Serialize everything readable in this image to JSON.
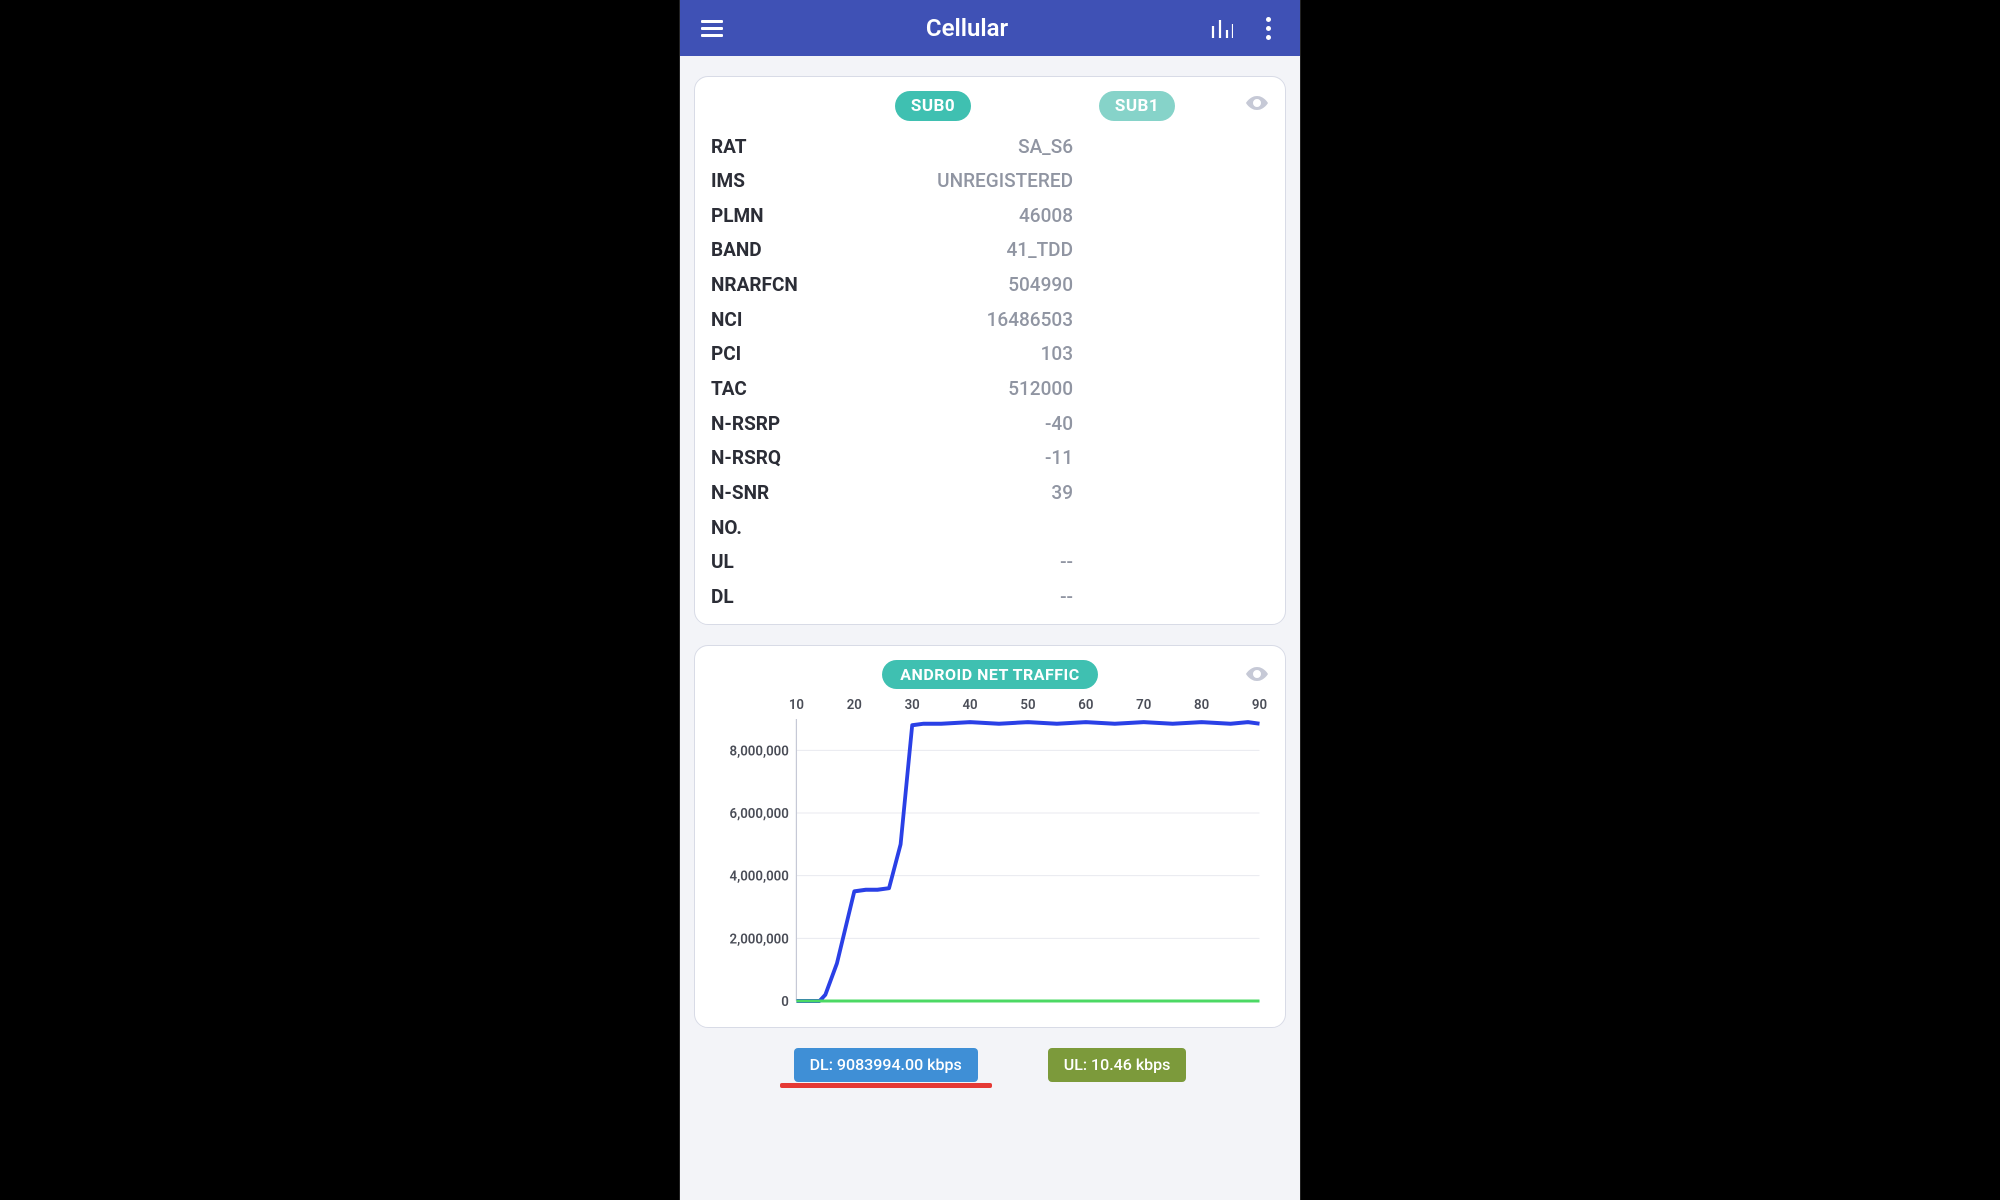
{
  "header": {
    "title": "Cellular"
  },
  "sim_card": {
    "sub0_label": "SUB0",
    "sub1_label": "SUB1",
    "rows": [
      {
        "key": "RAT",
        "val": "SA_S6"
      },
      {
        "key": "IMS",
        "val": "UNREGISTERED"
      },
      {
        "key": "PLMN",
        "val": "46008"
      },
      {
        "key": "BAND",
        "val": "41_TDD"
      },
      {
        "key": "NRARFCN",
        "val": "504990"
      },
      {
        "key": "NCI",
        "val": "16486503"
      },
      {
        "key": "PCI",
        "val": "103"
      },
      {
        "key": "TAC",
        "val": "512000"
      },
      {
        "key": "N-RSRP",
        "val": "-40"
      },
      {
        "key": "N-RSRQ",
        "val": "-11"
      },
      {
        "key": "N-SNR",
        "val": "39"
      },
      {
        "key": "NO.",
        "val": ""
      },
      {
        "key": "UL",
        "val": "--"
      },
      {
        "key": "DL",
        "val": "--"
      }
    ]
  },
  "traffic": {
    "title": "ANDROID NET TRAFFIC",
    "dl_label": "DL: 9083994.00 kbps",
    "ul_label": "UL: 10.46 kbps"
  },
  "chart_data": {
    "type": "line",
    "title": "ANDROID NET TRAFFIC",
    "xlabel": "",
    "ylabel": "",
    "xlim": [
      10,
      90
    ],
    "ylim": [
      0,
      9000000
    ],
    "x_ticks": [
      10,
      20,
      30,
      40,
      50,
      60,
      70,
      80,
      90
    ],
    "y_ticks": [
      0,
      2000000,
      4000000,
      6000000,
      8000000
    ],
    "y_tick_labels": [
      "0",
      "2,000,000",
      "4,000,000",
      "6,000,000",
      "8,000,000"
    ],
    "series": [
      {
        "name": "DL",
        "color": "#2a40e6",
        "x": [
          10,
          12,
          14,
          15,
          17,
          20,
          22,
          24,
          26,
          28,
          30,
          32,
          35,
          40,
          45,
          50,
          55,
          60,
          65,
          70,
          75,
          80,
          85,
          88,
          90
        ],
        "values": [
          0,
          0,
          0,
          200000,
          1200000,
          3500000,
          3550000,
          3550000,
          3600000,
          5000000,
          8800000,
          8850000,
          8850000,
          8900000,
          8850000,
          8900000,
          8850000,
          8900000,
          8850000,
          8900000,
          8850000,
          8900000,
          8850000,
          8900000,
          8850000
        ]
      },
      {
        "name": "UL",
        "color": "#4cd964",
        "x": [
          10,
          90
        ],
        "values": [
          10,
          10
        ]
      }
    ]
  }
}
